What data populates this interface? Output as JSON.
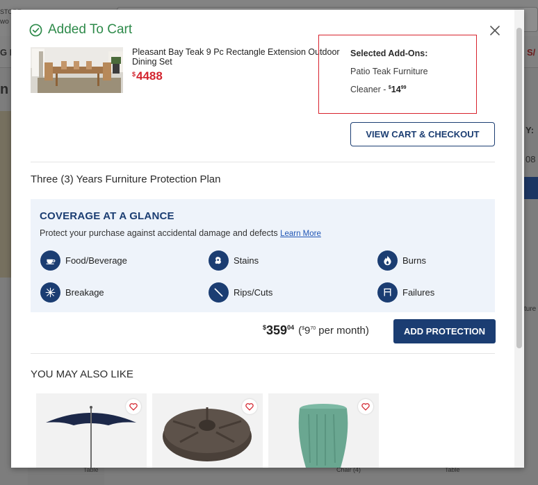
{
  "background": {
    "top_left_text_1": "STORE",
    "top_left_text_2": "wo",
    "nav_left_text": "G I",
    "nav_right_text": "S/",
    "side_text_n": "n",
    "right_text_y": "Y:",
    "right_text_08": "08",
    "right_text_ture": "ture",
    "bottom_text_1": "Table",
    "bottom_text_2": "Chair (4)",
    "bottom_text_3": "Table"
  },
  "modal": {
    "header": "Added To Cart",
    "close_icon": "close-icon",
    "product": {
      "name": "Pleasant Bay Teak 9 Pc Rectangle Extension Outdoor Dining Set",
      "price_symbol": "$",
      "price": "4488"
    },
    "addons": {
      "title": "Selected Add-Ons:",
      "item": "Patio Teak Furniture Cleaner - ",
      "price_symbol": "$",
      "price_dollars": "14",
      "price_cents": "99"
    },
    "view_cart_label": "VIEW CART & CHECKOUT",
    "plan_title": "Three (3) Years Furniture Protection Plan",
    "coverage": {
      "title": "COVERAGE AT A GLANCE",
      "description": "Protect your purchase against accidental damage and defects",
      "learn_more": "Learn More",
      "items": [
        {
          "label": "Food/Beverage",
          "icon": "food-beverage-icon"
        },
        {
          "label": "Stains",
          "icon": "stains-icon"
        },
        {
          "label": "Burns",
          "icon": "burns-icon"
        },
        {
          "label": "Breakage",
          "icon": "breakage-icon"
        },
        {
          "label": "Rips/Cuts",
          "icon": "rips-cuts-icon"
        },
        {
          "label": "Failures",
          "icon": "failures-icon"
        }
      ]
    },
    "plan_price": {
      "symbol": "$",
      "dollars": "359",
      "cents": "04",
      "monthly_open": "(",
      "monthly_symbol": "$",
      "monthly_dollars": "9",
      "monthly_cents": "70",
      "monthly_suffix": " per month)"
    },
    "add_protection_label": "ADD PROTECTION",
    "ymal_title": "YOU MAY ALSO LIKE",
    "recommendations": [
      {
        "name": "patio-umbrella",
        "icon": "heart-icon"
      },
      {
        "name": "umbrella-base",
        "icon": "heart-icon"
      },
      {
        "name": "ceramic-garden-stool",
        "icon": "heart-icon"
      }
    ]
  },
  "colors": {
    "success_green": "#2e8a4a",
    "price_red": "#d3252f",
    "brand_navy": "#1b3d72",
    "highlight_red": "#d8212c",
    "coverage_bg": "#eef3fa"
  }
}
